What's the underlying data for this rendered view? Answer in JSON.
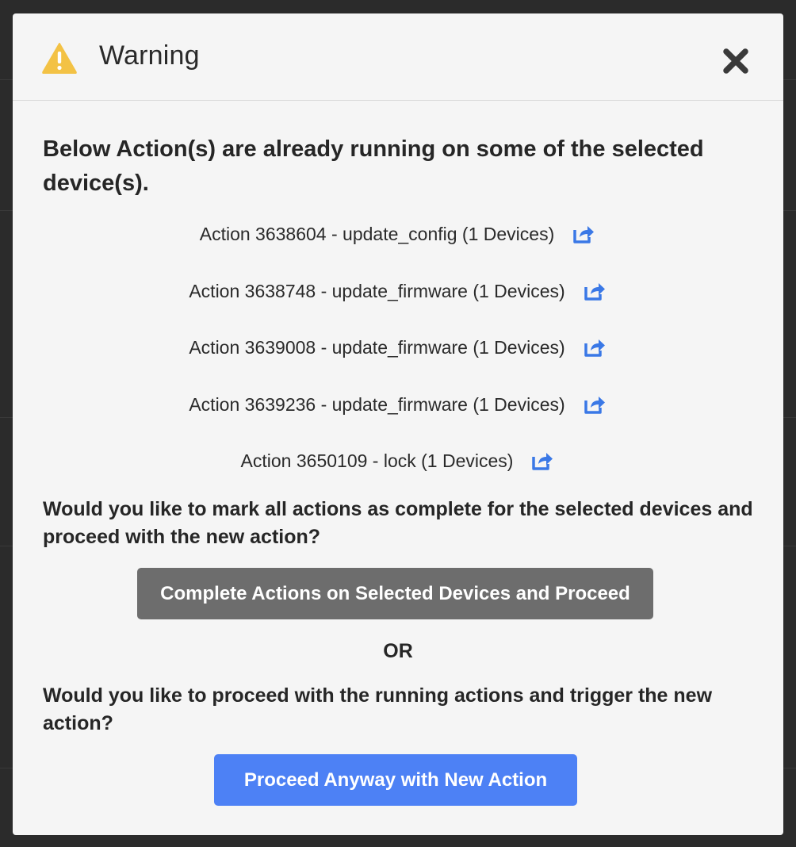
{
  "dialog": {
    "title": "Warning",
    "intro": "Below Action(s) are already running on some of the selected device(s).",
    "actions": [
      {
        "text": "Action 3638604 - update_config (1 Devices)"
      },
      {
        "text": "Action 3638748 - update_firmware (1 Devices)"
      },
      {
        "text": "Action 3639008 - update_firmware (1 Devices)"
      },
      {
        "text": "Action 3639236 - update_firmware (1 Devices)"
      },
      {
        "text": "Action 3650109 - lock (1 Devices)"
      }
    ],
    "question_complete": "Would you like to mark all actions as complete for the selected devices and proceed with the new action?",
    "complete_button_label": "Complete Actions on Selected Devices and Proceed",
    "or_label": "OR",
    "question_proceed": "Would you like to proceed with the running actions and trigger the new action?",
    "proceed_button_label": "Proceed Anyway with New Action"
  },
  "icons": {
    "header": "warning-triangle-icon",
    "close": "close-icon",
    "action_link": "external-link-icon"
  },
  "colors": {
    "warning": "#f3c245",
    "link": "#3a78e6",
    "complete_button": "#6d6d6d",
    "proceed_button": "#4d81f5"
  }
}
